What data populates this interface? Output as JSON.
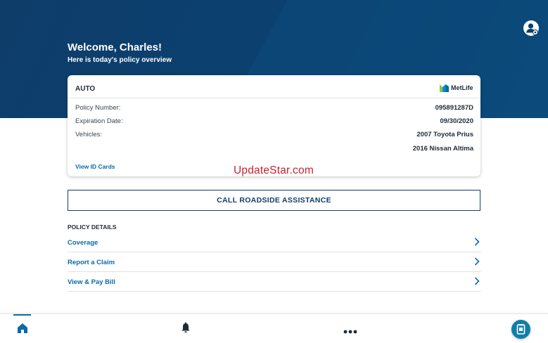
{
  "header": {
    "welcome": "Welcome, Charles!",
    "subtitle": "Here is today's policy overview"
  },
  "policy_card": {
    "type": "AUTO",
    "insurer": "MetLife",
    "rows": [
      {
        "label": "Policy Number:",
        "value": "095891287D"
      },
      {
        "label": "Expiration Date:",
        "value": "09/30/2020"
      },
      {
        "label": "Vehicles:",
        "value": "2007 Toyota Prius"
      },
      {
        "label": "",
        "value": "2016 Nissan Altima"
      }
    ],
    "link": "View ID Cards"
  },
  "watermark": "UpdateStar.com",
  "roadside_button": "CALL ROADSIDE ASSISTANCE",
  "policy_details": {
    "title": "POLICY DETAILS",
    "items": [
      {
        "label": "Coverage"
      },
      {
        "label": "Report a Claim"
      },
      {
        "label": "View & Pay Bill"
      }
    ]
  },
  "nav": {
    "items": [
      {
        "icon": "home-icon",
        "active": true
      },
      {
        "icon": "bell-icon",
        "active": false
      },
      {
        "icon": "more-icon",
        "active": false
      }
    ],
    "fab_icon": "id-card-icon"
  },
  "colors": {
    "header_bg": "#0e3d6a",
    "link_blue": "#0a6aa8",
    "navy": "#123d69",
    "fab": "#0f7fa8",
    "watermark_red": "#c8222b",
    "metlife_green": "#8dc63f",
    "metlife_blue": "#0090da"
  }
}
